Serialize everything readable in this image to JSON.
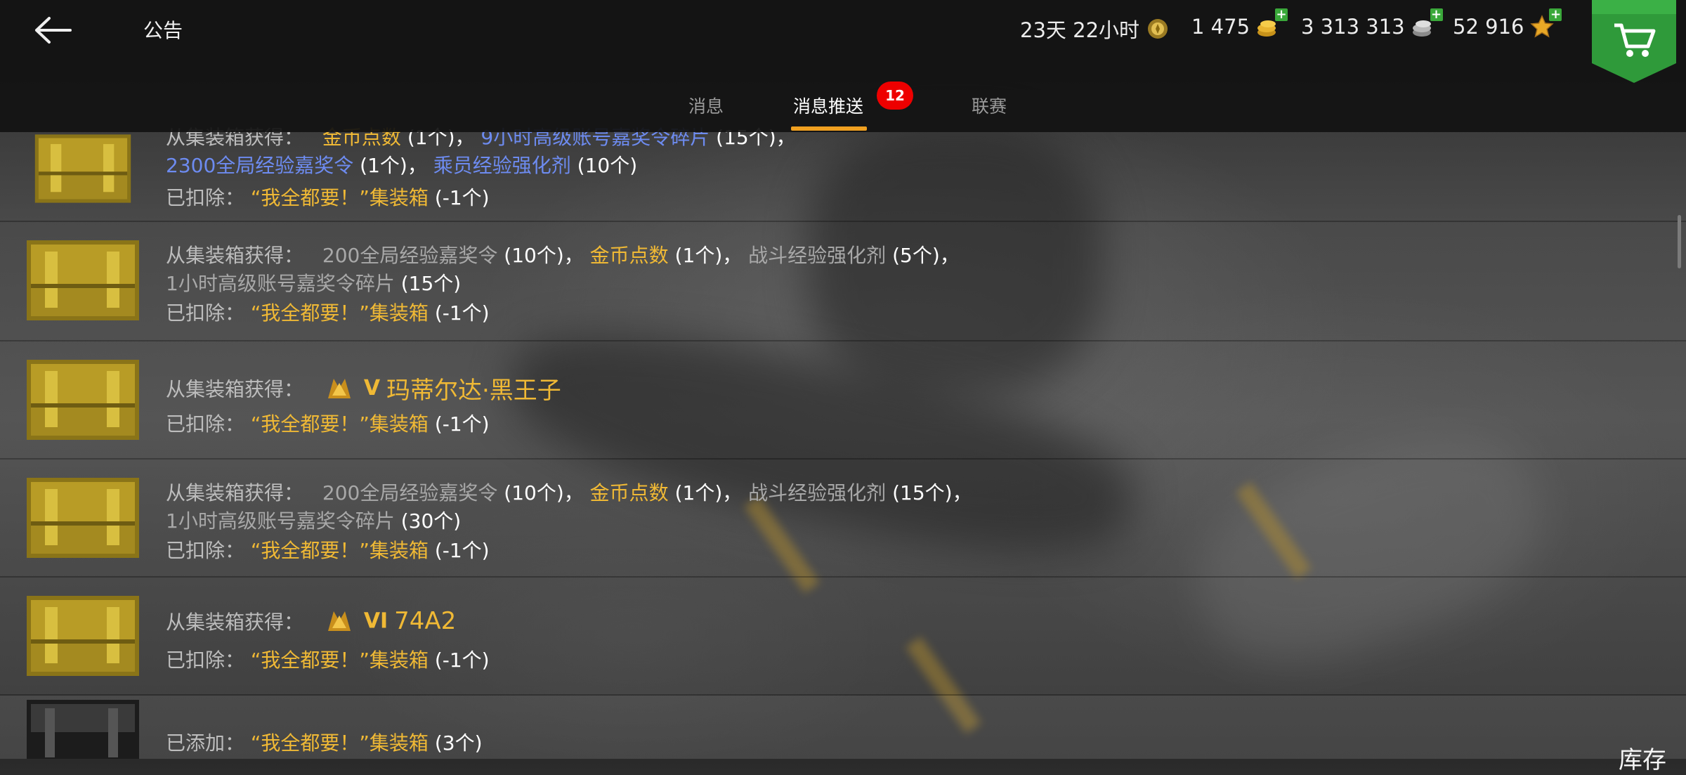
{
  "header": {
    "title": "公告",
    "timer": "23天 22小时",
    "gold": "1 475",
    "silver": "3 313 313",
    "free_xp": "52 916"
  },
  "tabs": [
    {
      "label": "消息"
    },
    {
      "label": "消息推送",
      "badge": "12",
      "active": true
    },
    {
      "label": "联赛"
    }
  ],
  "messages": [
    {
      "line0_partial": [
        "从集装箱获得：",
        "金币点数",
        "(1个)，",
        "9小时高级账号嘉奖令碎片",
        "(15个)，"
      ],
      "line1": [
        "2300全局经验嘉奖令",
        "(1个)，",
        "乘员经验强化剂",
        "(10个)"
      ],
      "deduct_label": "已扣除：",
      "deduct_item": "“我全都要！”集装箱",
      "deduct_count": "(-1个)"
    },
    {
      "obtain_label": "从集装箱获得：",
      "items": [
        "200全局经验嘉奖令",
        "(10个)，",
        "金币点数",
        "(1个)，",
        "战斗经验强化剂",
        "(5个)，"
      ],
      "line2": [
        "1小时高级账号嘉奖令碎片",
        "(15个)"
      ],
      "deduct_label": "已扣除：",
      "deduct_item": "“我全都要！”集装箱",
      "deduct_count": "(-1个)"
    },
    {
      "obtain_label": "从集装箱获得：",
      "tier": "V",
      "tank": "玛蒂尔达·黑王子",
      "deduct_label": "已扣除：",
      "deduct_item": "“我全都要！”集装箱",
      "deduct_count": "(-1个)"
    },
    {
      "obtain_label": "从集装箱获得：",
      "items": [
        "200全局经验嘉奖令",
        "(10个)，",
        "金币点数",
        "(1个)，",
        "战斗经验强化剂",
        "(15个)，"
      ],
      "line2": [
        "1小时高级账号嘉奖令碎片",
        "(30个)"
      ],
      "deduct_label": "已扣除：",
      "deduct_item": "“我全都要！”集装箱",
      "deduct_count": "(-1个)"
    },
    {
      "obtain_label": "从集装箱获得：",
      "tier": "VI",
      "tank": "74A2",
      "deduct_label": "已扣除：",
      "deduct_item": "“我全都要！”集装箱",
      "deduct_count": "(-1个)"
    },
    {
      "added_label": "已添加：",
      "added_item": "“我全都要！”集装箱",
      "added_count": "(3个)"
    }
  ],
  "footer": {
    "inventory_label": "库存"
  },
  "colors": {
    "accent": "#f0a020",
    "gold_text": "#f0b935",
    "blue_text": "#6d8bf0",
    "badge_red": "#e00000",
    "shop_green": "#2f9a3a"
  },
  "icons": {
    "back": "arrow-left-icon",
    "timer": "laurel-medal-icon",
    "gold": "gold-coins-icon",
    "silver": "silver-coins-icon",
    "free_xp": "star-icon",
    "shop": "cart-icon"
  }
}
